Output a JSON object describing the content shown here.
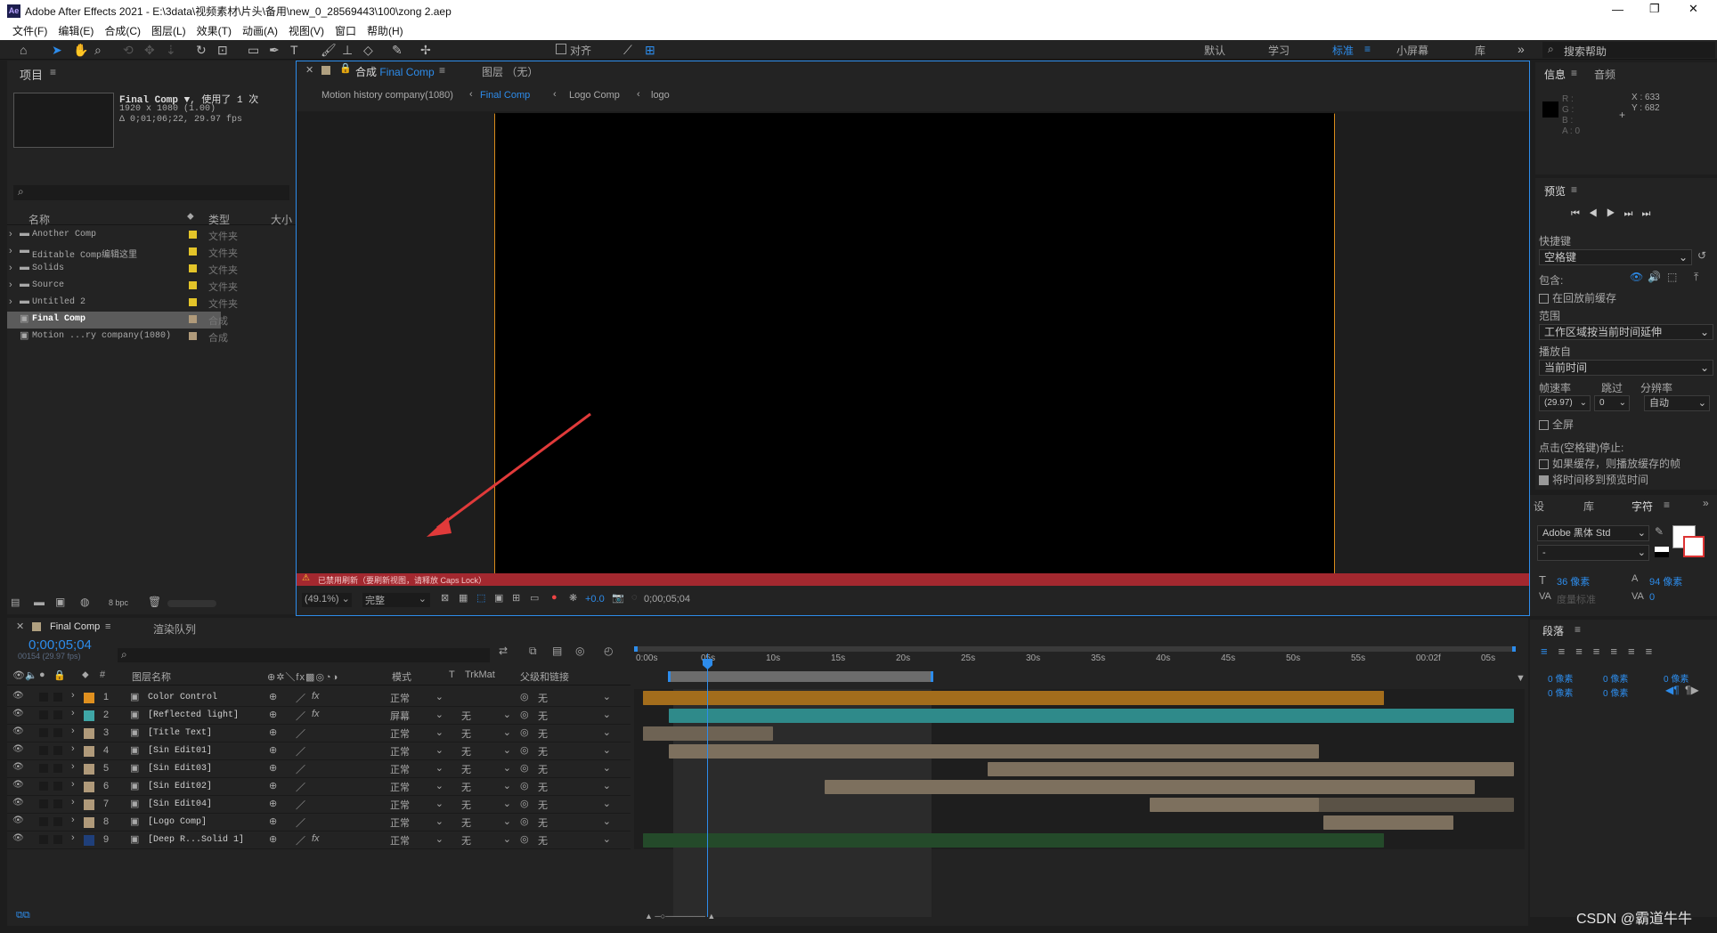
{
  "window": {
    "title": "Adobe After Effects 2021 - E:\\3data\\视频素材\\片头\\备用\\new_0_28569443\\100\\zong 2.aep",
    "app_icon": "Ae",
    "controls": [
      "—",
      "❐",
      "✕"
    ]
  },
  "menu": [
    "文件(F)",
    "编辑(E)",
    "合成(C)",
    "图层(L)",
    "效果(T)",
    "动画(A)",
    "视图(V)",
    "窗口",
    "帮助(H)"
  ],
  "toolbar": {
    "align_label": "对齐",
    "workspaces": [
      "默认",
      "学习",
      "标准",
      "小屏幕",
      "库"
    ],
    "search_placeholder": "搜索帮助"
  },
  "project": {
    "title": "项目",
    "comp_name": "Final Comp ▼",
    "used": ", 使用了 1 次",
    "res": "1920 x 1080 (1.00)",
    "dur": "Δ 0;01;06;22, 29.97 fps",
    "col_name": "名称",
    "col_type": "类型",
    "col_size": "大小",
    "items": [
      {
        "name": "Another Comp",
        "type": "文件夹",
        "kind": "folder"
      },
      {
        "name": "Editable Comp编辑这里",
        "type": "文件夹",
        "kind": "folder"
      },
      {
        "name": "Solids",
        "type": "文件夹",
        "kind": "folder"
      },
      {
        "name": "Source",
        "type": "文件夹",
        "kind": "folder"
      },
      {
        "name": "Untitled 2",
        "type": "文件夹",
        "kind": "folder"
      },
      {
        "name": "Final Comp",
        "type": "合成",
        "kind": "comp"
      },
      {
        "name": "Motion ...ry company(1080)",
        "type": "合成",
        "kind": "comp"
      }
    ],
    "bpc": "8 bpc"
  },
  "viewer": {
    "tab_prefix": "合成",
    "tab_name": "Final Comp",
    "layer_tab": "图层 （无）",
    "breadcrumbs": [
      "Motion history company(1080)",
      "Final Comp",
      "Logo Comp",
      "logo"
    ],
    "warning": "已禁用刷新（要刷新视图，请释放 Caps Lock）",
    "zoom": "(49.1%)",
    "quality": "完整",
    "exposure": "+0.0",
    "timecode": "0;00;05;04"
  },
  "info": {
    "tab": "信息",
    "audio_tab": "音频",
    "r": "R :",
    "g": "G :",
    "b": "B :",
    "a": "A : 0",
    "x": "X : 633",
    "y": "Y : 682"
  },
  "preview": {
    "title": "预览",
    "shortcut_label": "快捷键",
    "shortcut": "空格键",
    "include": "包含:",
    "cache_label": "在回放前缓存",
    "range_label": "范围",
    "range": "工作区域按当前时间延伸",
    "play_from_label": "播放自",
    "play_from": "当前时间",
    "fps_label": "帧速率",
    "skip_label": "跳过",
    "res_label": "分辨率",
    "fps": "(29.97)",
    "skip": "0",
    "res": "自动",
    "fullscreen": "全屏",
    "stop_label": "点击(空格键)停止:",
    "opt1": "如果缓存，则播放缓存的帧",
    "opt2": "将时间移到预览时间"
  },
  "character": {
    "tabs": [
      "设",
      "库",
      "字符"
    ],
    "font": "Adobe 黑体 Std",
    "style": "-",
    "size": "36 像素",
    "leading": "94 像素",
    "tracking_label": "度量标准",
    "kerning": "0"
  },
  "paragraph": {
    "title": "段落",
    "indent": "0 像素"
  },
  "timeline": {
    "tab": "Final Comp",
    "render_tab": "渲染队列",
    "timecode": "0;00;05;04",
    "frames": "00154 (29.97 fps)",
    "col_name": "图层名称",
    "col_mode": "模式",
    "col_t": "T",
    "col_trk": "TrkMat",
    "col_parent": "父级和链接",
    "ruler": [
      "0:00s",
      "05s",
      "10s",
      "15s",
      "20s",
      "25s",
      "30s",
      "35s",
      "40s",
      "45s",
      "50s",
      "55s",
      "00:02f",
      "05s"
    ],
    "layers": [
      {
        "num": "1",
        "name": "Color Control",
        "label": "#e0901f",
        "fx": true,
        "mode": "正常",
        "trk": "",
        "parent": "无",
        "bar": "#a36d1c",
        "dim": "#a36d1c",
        "start": 0,
        "end": 57
      },
      {
        "num": "2",
        "name": "[Reflected light]",
        "label": "#3fa6a6",
        "fx": true,
        "mode": "屏幕",
        "trk": "无",
        "parent": "无",
        "bar": "#2f8a8a",
        "dim": "#2a6d6d",
        "start": 2,
        "end": 67
      },
      {
        "num": "3",
        "name": "[Title Text]",
        "label": "#b09a7a",
        "fx": false,
        "mode": "正常",
        "trk": "无",
        "parent": "无",
        "bar": "#6e6354",
        "dim": "#4b453d",
        "start": 0,
        "end": 10
      },
      {
        "num": "4",
        "name": "[Sin Edit01]",
        "label": "#b09a7a",
        "fx": false,
        "mode": "正常",
        "trk": "无",
        "parent": "无",
        "bar": "#7d705e",
        "dim": "#5a5246",
        "start": 2,
        "end": 52
      },
      {
        "num": "5",
        "name": "[Sin Edit03]",
        "label": "#b09a7a",
        "fx": false,
        "mode": "正常",
        "trk": "无",
        "parent": "无",
        "bar": "#7d705e",
        "dim": "#5a5246",
        "start": 26.5,
        "end": 67
      },
      {
        "num": "6",
        "name": "[Sin Edit02]",
        "label": "#b09a7a",
        "fx": false,
        "mode": "正常",
        "trk": "无",
        "parent": "无",
        "bar": "#7d705e",
        "dim": "#5a5246",
        "start": 14,
        "end": 64
      },
      {
        "num": "7",
        "name": "[Sin Edit04]",
        "label": "#b09a7a",
        "fx": false,
        "mode": "正常",
        "trk": "无",
        "parent": "无",
        "bar": "#7d705e",
        "dim": "#5a5246",
        "start": 39,
        "end": 67
      },
      {
        "num": "8",
        "name": "[Logo Comp]",
        "label": "#b09a7a",
        "fx": false,
        "mode": "正常",
        "trk": "无",
        "parent": "无",
        "bar": "#7d705e",
        "dim": "#5a5246",
        "start": 52.3,
        "end": 62.3
      },
      {
        "num": "9",
        "name": "[Deep R...Solid 1]",
        "label": "#1f3f7a",
        "fx": true,
        "mode": "正常",
        "trk": "无",
        "parent": "无",
        "bar": "#244a2a",
        "dim": "#244a2a",
        "start": 0,
        "end": 57
      }
    ]
  },
  "watermark": "CSDN @霸道牛牛",
  "colors": {
    "accent": "#2d8ceb",
    "warning": "#a3282f",
    "frame": "#d98c1a"
  }
}
